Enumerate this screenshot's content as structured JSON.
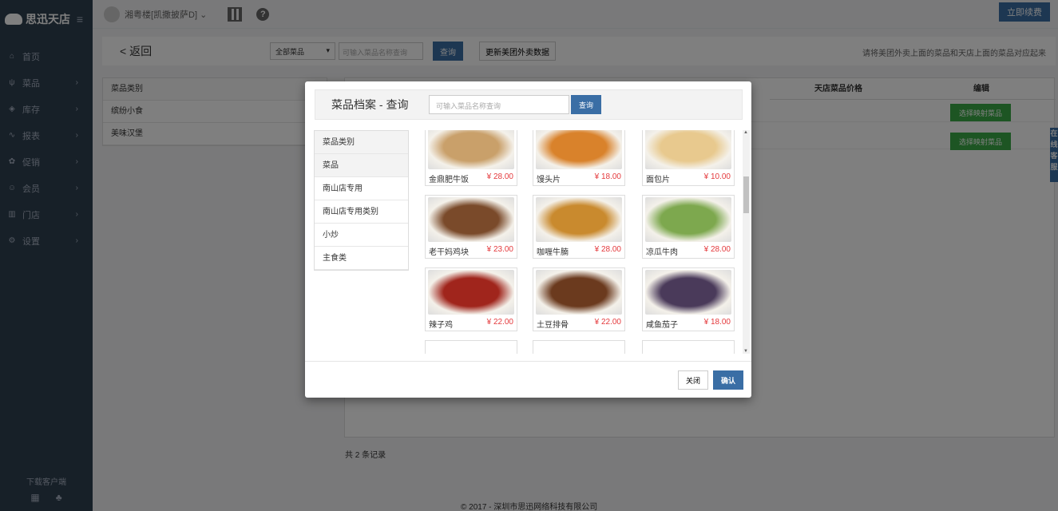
{
  "brand": {
    "name": "思迅天店"
  },
  "sidebar": {
    "items": [
      {
        "label": "首页",
        "icon": "home-icon",
        "glyph": "⌂"
      },
      {
        "label": "菜品",
        "icon": "cutlery-icon",
        "glyph": "ψ"
      },
      {
        "label": "库存",
        "icon": "cubes-icon",
        "glyph": "◈"
      },
      {
        "label": "报表",
        "icon": "chart-icon",
        "glyph": "∿"
      },
      {
        "label": "促销",
        "icon": "gift-icon",
        "glyph": "✿"
      },
      {
        "label": "会员",
        "icon": "users-icon",
        "glyph": "☺"
      },
      {
        "label": "门店",
        "icon": "bank-icon",
        "glyph": "▥"
      },
      {
        "label": "设置",
        "icon": "gear-icon",
        "glyph": "⚙"
      }
    ],
    "download_label": "下载客户端"
  },
  "topbar": {
    "store": "湘粤楼[凯撒披萨D]",
    "renew_label": "立即续费"
  },
  "toolbar": {
    "back_label": "< 返回",
    "category_select": "全部菜品",
    "search_placeholder": "可输入菜品名称查询",
    "query_label": "查询",
    "update_label": "更新美团外卖数据",
    "hint": "请将美团外卖上面的菜品和天店上面的菜品对应起来"
  },
  "category_table": {
    "header": "菜品类别",
    "rows": [
      "缤纷小食",
      "美味汉堡"
    ]
  },
  "main_table": {
    "headers": {
      "price": "天店菜品价格",
      "edit": "编辑"
    },
    "map_label": "选择映射菜品"
  },
  "footer": {
    "count": "共 2 条记录",
    "copyright": "© 2017 - 深圳市思迅网络科技有限公司"
  },
  "side_tab": "在线客服",
  "modal": {
    "title": "菜品档案 - 查询",
    "search_placeholder": "可输入菜品名称查询",
    "query_label": "查询",
    "categories": [
      "菜品类别",
      "菜品",
      "南山店专用",
      "南山店专用类别",
      "小炒",
      "主食类"
    ],
    "dishes": [
      {
        "name": "金鼎肥牛饭",
        "price": "¥ 28.00",
        "color": "#c9a06a"
      },
      {
        "name": "馒头片",
        "price": "¥ 18.00",
        "color": "#d9822b"
      },
      {
        "name": "面包片",
        "price": "¥ 10.00",
        "color": "#e8c98e"
      },
      {
        "name": "老干妈鸡块",
        "price": "¥ 23.00",
        "color": "#7a4a2a"
      },
      {
        "name": "咖喱牛腩",
        "price": "¥ 28.00",
        "color": "#c98a2e"
      },
      {
        "name": "凉瓜牛肉",
        "price": "¥ 28.00",
        "color": "#7da84e"
      },
      {
        "name": "辣子鸡",
        "price": "¥ 22.00",
        "color": "#a0251c"
      },
      {
        "name": "土豆排骨",
        "price": "¥ 22.00",
        "color": "#6b3a1e"
      },
      {
        "name": "咸鱼茄子",
        "price": "¥ 18.00",
        "color": "#4a3a5a"
      }
    ],
    "close_label": "关闭",
    "ok_label": "确认"
  }
}
